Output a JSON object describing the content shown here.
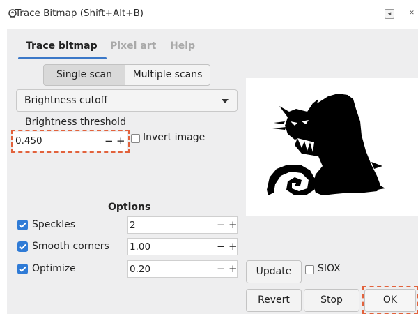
{
  "window": {
    "title": "Trace Bitmap (Shift+Alt+B)",
    "minimize_glyph": "◂",
    "close_glyph": "✕"
  },
  "tabs": [
    {
      "label": "Trace bitmap",
      "active": true
    },
    {
      "label": "Pixel art",
      "active": false
    },
    {
      "label": "Help",
      "active": false
    }
  ],
  "scan_modes": {
    "single": "Single scan",
    "multiple": "Multiple scans",
    "selected": "single"
  },
  "mode_select": {
    "value": "Brightness cutoff"
  },
  "threshold": {
    "label": "Brightness threshold",
    "value": "0.450",
    "minus": "−",
    "plus": "+",
    "invert_label": "Invert image",
    "invert_checked": false
  },
  "options": {
    "heading": "Options",
    "items": [
      {
        "label": "Speckles",
        "checked": true,
        "value": "2"
      },
      {
        "label": "Smooth corners",
        "checked": true,
        "value": "1.00"
      },
      {
        "label": "Optimize",
        "checked": true,
        "value": "0.20"
      }
    ],
    "minus": "−",
    "plus": "+"
  },
  "preview": {
    "update_label": "Update",
    "siox_label": "SIOX",
    "siox_checked": false
  },
  "actions": {
    "revert": "Revert",
    "stop": "Stop",
    "ok": "OK"
  },
  "colors": {
    "accent": "#3b78c8",
    "checkbox": "#2f7bd6",
    "highlight": "#e2623c",
    "panel": "#eeeeef"
  }
}
